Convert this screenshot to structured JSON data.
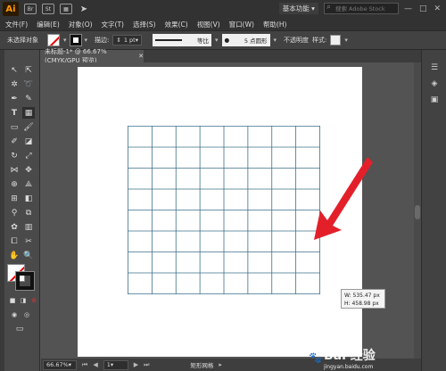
{
  "app": {
    "logo": "Ai",
    "bridge_icon": "Br",
    "stock_icon": "St",
    "workspace": "基本功能",
    "search_placeholder": "搜索 Adobe Stock",
    "window_controls": [
      "—",
      "□",
      "✕"
    ]
  },
  "menu": [
    "文件(F)",
    "编辑(E)",
    "对象(O)",
    "文字(T)",
    "选择(S)",
    "效果(C)",
    "视图(V)",
    "窗口(W)",
    "帮助(H)"
  ],
  "control_bar": {
    "selection_label": "未选择对象",
    "stroke_label": "描边:",
    "stroke_weight": "1 pt",
    "stroke_profile": "等比",
    "brush_size": "5 点圆形",
    "opacity_label": "不透明度",
    "style_label": "样式:"
  },
  "document": {
    "tab_title": "未标题-1* @ 66.67% (CMYK/GPU 预览)",
    "close_glyph": "✕",
    "grid": {
      "columns": 8,
      "rows": 8,
      "color": "#3d6f8a"
    },
    "tooltip_w": "W: 535.47 px",
    "tooltip_h": "H: 458.98 px",
    "arrow_color": "#e3202a"
  },
  "status": {
    "zoom": "66.67%",
    "artboard": "1",
    "tool_name": "矩形网格"
  },
  "watermark": "Bai 经验",
  "watermark_sub": "jingyan.baidu.com"
}
